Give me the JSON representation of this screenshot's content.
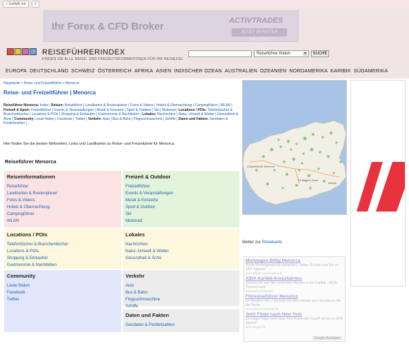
{
  "topbar": {
    "liked_label": "Gefällt mir",
    "liked_count": "2"
  },
  "ad_banner": {
    "headline": "Ihr Forex & CFD Broker",
    "brand": "ACTIVTRADES",
    "cta": "JETZT BERATER TESTEN"
  },
  "logo": {
    "title": "REISEFÜHRERINDEX",
    "tagline": "FINDEN SIE ALLE REISE- UND FREIZEITINFORMATIONEN FÜR IHR REISEZIEL"
  },
  "search": {
    "select_value": "Reiseführer finden",
    "button_label": "SUCHE"
  },
  "nav": [
    "EUROPA",
    "DEUTSCHLAND",
    "SCHWEIZ",
    "ÖSTERREICH",
    "AFRIKA",
    "ASIEN",
    "INDISCHER OZEAN",
    "AUSTRALIEN",
    "OZEANIEN",
    "NORDAMERIKA",
    "KARIBIK",
    "SÜDAMERIKA"
  ],
  "breadcrumb": "Hauptseite » Reise- und Freizeitführer » Menorca",
  "page_title": "Reise- und Freizeitführer | Menorca",
  "categories": [
    {
      "label": "Reiseführer Menorca:",
      "links": [
        "Index"
      ]
    },
    {
      "label": "Reisen:",
      "links": [
        "Reiseführer",
        "Landkarten & Routenplaner",
        "Fotos & Videos",
        "Hotels & Übernachtung",
        "Campingführer",
        "WLAN"
      ]
    },
    {
      "label": "Freizeit & Sport:",
      "links": [
        "Freizeitführer",
        "Events & Veranstaltungen",
        "Musik & Konzerte",
        "Sport & Outdoor",
        "Ski",
        "Motorrad"
      ]
    },
    {
      "label": "Locations / POIs:",
      "links": [
        "Telefonbücher & Branchenbücher",
        "Locations & POIs",
        "Shopping & Einkaufen",
        "Gastronomie & Nachtleben"
      ]
    },
    {
      "label": "Lokales:",
      "links": [
        "Nachrichten",
        "Natur, Umwelt & Wetter",
        "Gesundheit & Ärzte"
      ]
    },
    {
      "label": "Community:",
      "links": [
        "Leute finden",
        "Facebook",
        "Twitter"
      ]
    },
    {
      "label": "Verkehr:",
      "links": [
        "Auto",
        "Bus & Bahn",
        "Flugsuchmaschine",
        "Schiffe"
      ]
    },
    {
      "label": "Daten und Fakten:",
      "links": [
        "Geodaten & Postleitzahlen"
      ]
    }
  ],
  "intro": "Hier finden Sie die besten Webseiten, Links und Landkarten zu Reise- und Freizeitziele für Menorca.",
  "guide_title": "Reiseführer Menorca",
  "boxes": {
    "reise": {
      "title": "Reiseinformationen",
      "links": [
        "Reiseführer",
        "Landkarten & Routenplaner",
        "Fotos & Videos",
        "Hotels & Übernachtung",
        "Campingführer",
        "WLAN"
      ]
    },
    "freizeit": {
      "title": "Freizeit & Outdoor",
      "links": [
        "Freizeitführer",
        "Events & Veranstaltungen",
        "Musik & Konzerte",
        "Sport & Outdoor",
        "Ski",
        "Motorrad"
      ]
    },
    "locations": {
      "title": "Locations / POIs",
      "links": [
        "Telefonbücher & Branchenbücher",
        "Locations & POIs",
        "Shopping & Einkaufen",
        "Gastronomie & Nachtleben"
      ]
    },
    "lokales": {
      "title": "Lokales",
      "links": [
        "Nachrichten",
        "Natur, Umwelt & Wetter",
        "Gesundheit & Ärzte"
      ]
    },
    "community": {
      "title": "Community",
      "links": [
        "Leute finden",
        "Facebook",
        "Twitter"
      ]
    },
    "verkehr": {
      "title": "Verkehr",
      "links": [
        "Auto",
        "Bus & Bahn",
        "Flugsuchmaschine",
        "Schiffe"
      ]
    },
    "daten": {
      "title": "Daten und Fakten",
      "links": [
        "Geodaten & Postleitzahlen"
      ]
    }
  },
  "map": {
    "label_ciutadella": "Ciutadella de Menorca",
    "label_mao": "Mahón",
    "label_es_migjorn": "Es Migjorn Gran"
  },
  "map_caption": {
    "prefix": "Weiter zur ",
    "link": "Reisekarte",
    "suffix": "."
  },
  "ads": [
    {
      "title": "Mietwagen Billig Menorca",
      "desc": "Beste Mietwagenpreise garantiert. Online Buchen und Bis zu 19% Sparen!",
      "url": "www.billiger-mietwagen.de"
    },
    {
      "title": "AIDA Karibik-Kreuzfahrten",
      "desc": "Dramen für aus den schönsten Routen in der Karibik - AIDA Traumurlaub!",
      "url": "www.aida.de/karibik"
    },
    {
      "title": "Filmreiseführer Menorca",
      "desc": "Im Minuten Film + Booklet mit allen Details zum Nachlesen für die Reise",
      "url": "www.filmreisefuehrer.de"
    },
    {
      "title": "Jetzt Flüge nach New York",
      "desc": "Günstige Flüge nach New York finden Mit Flug24 ab bis zu 60% sparen!",
      "url": "www.flug24.de"
    }
  ],
  "google_ad_label": "Google-Anzeigen",
  "colors": {
    "reise_bg": "#fbe3e3",
    "freizeit_bg": "#e3f3dc",
    "locations_bg": "#fdf7dd",
    "lokales_bg": "#fdf7dd",
    "community_bg": "#e2e6fb",
    "verkehr_bg": "#ececec",
    "link": "#1a5fb4"
  }
}
